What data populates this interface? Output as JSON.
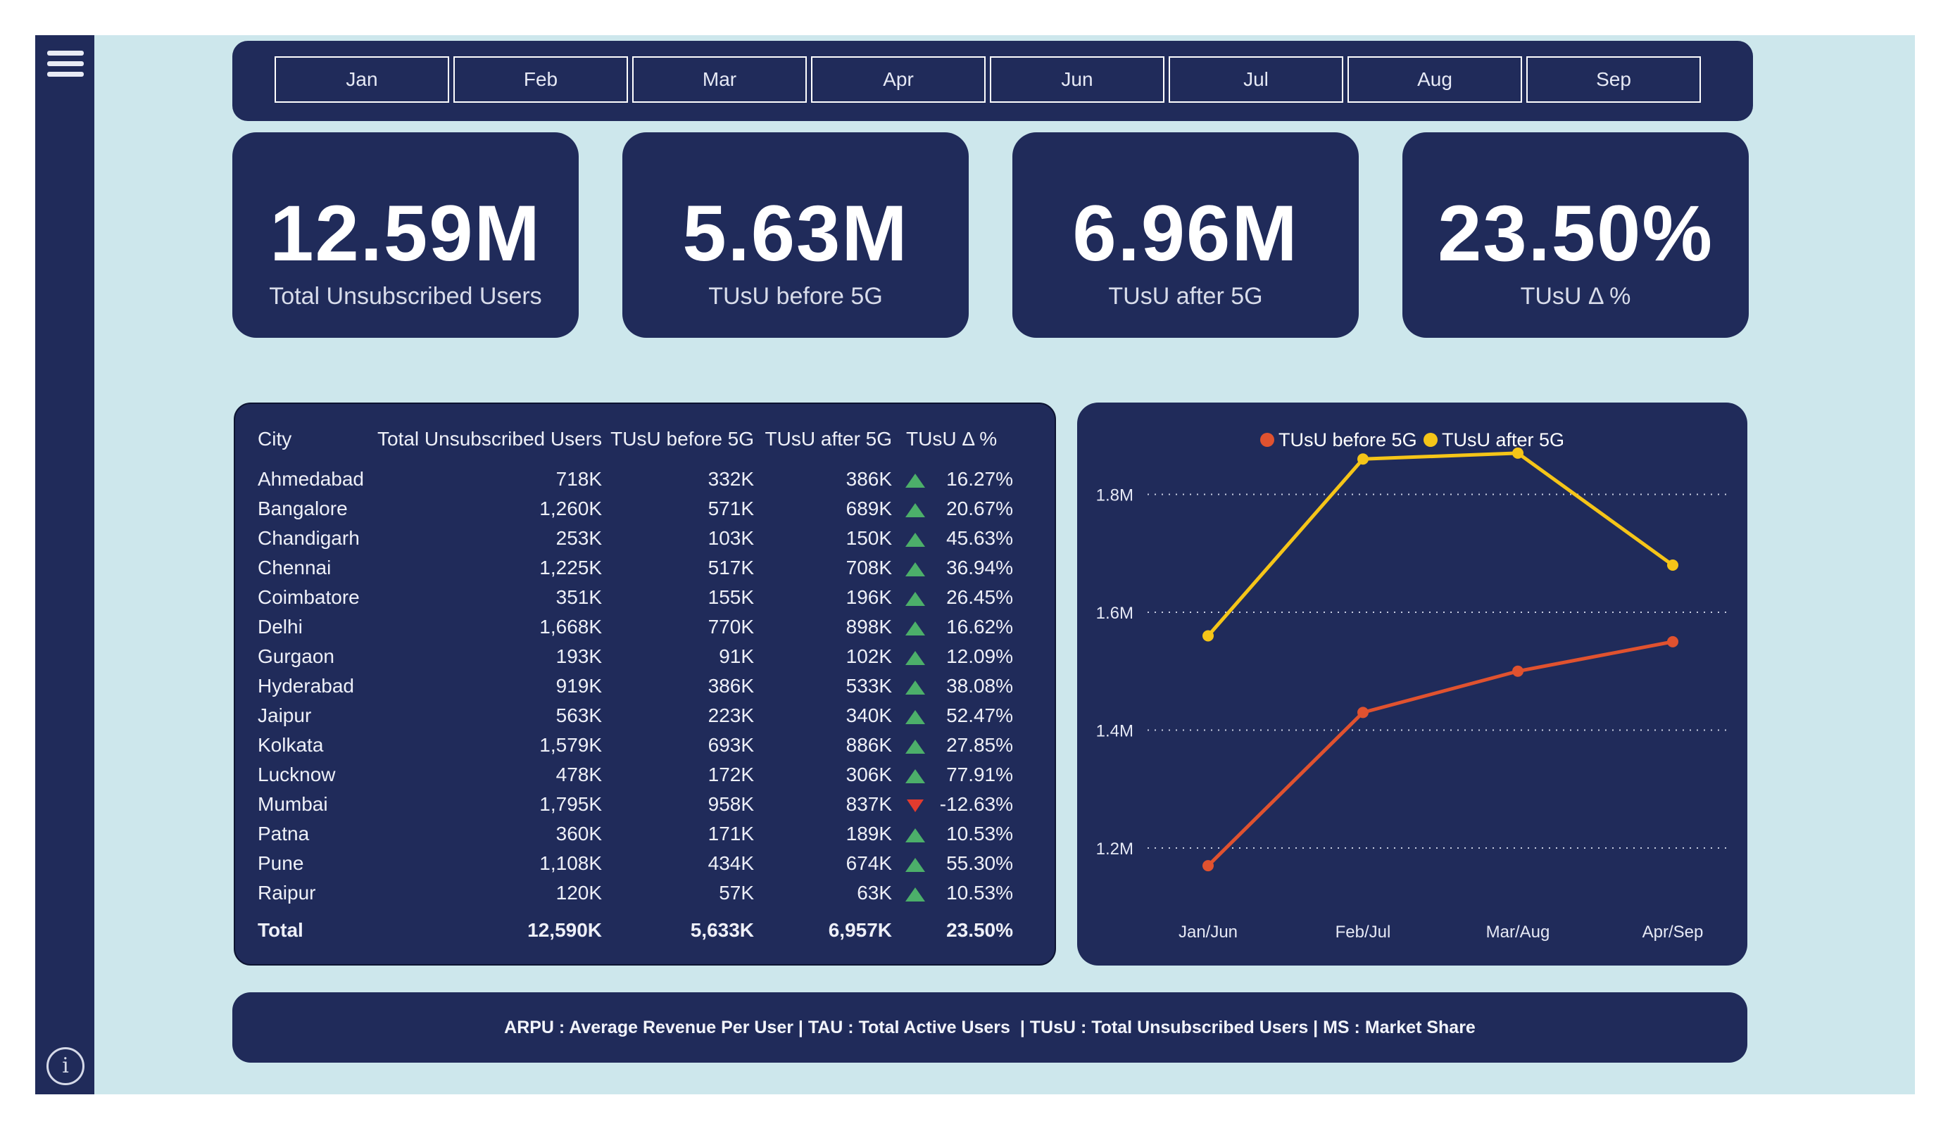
{
  "nav": {
    "months": [
      "Jan",
      "Feb",
      "Mar",
      "Apr",
      "Jun",
      "Jul",
      "Aug",
      "Sep"
    ],
    "info_label": "i"
  },
  "kpis": [
    {
      "value": "12.59M",
      "label": "Total Unsubscribed Users"
    },
    {
      "value": "5.63M",
      "label": "TUsU before 5G"
    },
    {
      "value": "6.96M",
      "label": "TUsU after 5G"
    },
    {
      "value": "23.50%",
      "label": "TUsU Δ %"
    }
  ],
  "table": {
    "headers": [
      "City",
      "Total Unsubscribed Users",
      "TUsU before 5G",
      "TUsU after 5G",
      "TUsU Δ %"
    ],
    "rows": [
      {
        "city": "Ahmedabad",
        "total": "718K",
        "before": "332K",
        "after": "386K",
        "trend": "up",
        "pct": "16.27%"
      },
      {
        "city": "Bangalore",
        "total": "1,260K",
        "before": "571K",
        "after": "689K",
        "trend": "up",
        "pct": "20.67%"
      },
      {
        "city": "Chandigarh",
        "total": "253K",
        "before": "103K",
        "after": "150K",
        "trend": "up",
        "pct": "45.63%"
      },
      {
        "city": "Chennai",
        "total": "1,225K",
        "before": "517K",
        "after": "708K",
        "trend": "up",
        "pct": "36.94%"
      },
      {
        "city": "Coimbatore",
        "total": "351K",
        "before": "155K",
        "after": "196K",
        "trend": "up",
        "pct": "26.45%"
      },
      {
        "city": "Delhi",
        "total": "1,668K",
        "before": "770K",
        "after": "898K",
        "trend": "up",
        "pct": "16.62%"
      },
      {
        "city": "Gurgaon",
        "total": "193K",
        "before": "91K",
        "after": "102K",
        "trend": "up",
        "pct": "12.09%"
      },
      {
        "city": "Hyderabad",
        "total": "919K",
        "before": "386K",
        "after": "533K",
        "trend": "up",
        "pct": "38.08%"
      },
      {
        "city": "Jaipur",
        "total": "563K",
        "before": "223K",
        "after": "340K",
        "trend": "up",
        "pct": "52.47%"
      },
      {
        "city": "Kolkata",
        "total": "1,579K",
        "before": "693K",
        "after": "886K",
        "trend": "up",
        "pct": "27.85%"
      },
      {
        "city": "Lucknow",
        "total": "478K",
        "before": "172K",
        "after": "306K",
        "trend": "up",
        "pct": "77.91%"
      },
      {
        "city": "Mumbai",
        "total": "1,795K",
        "before": "958K",
        "after": "837K",
        "trend": "down",
        "pct": "-12.63%"
      },
      {
        "city": "Patna",
        "total": "360K",
        "before": "171K",
        "after": "189K",
        "trend": "up",
        "pct": "10.53%"
      },
      {
        "city": "Pune",
        "total": "1,108K",
        "before": "434K",
        "after": "674K",
        "trend": "up",
        "pct": "55.30%"
      },
      {
        "city": "Raipur",
        "total": "120K",
        "before": "57K",
        "after": "63K",
        "trend": "up",
        "pct": "10.53%"
      }
    ],
    "total": {
      "city": "Total",
      "total": "12,590K",
      "before": "5,633K",
      "after": "6,957K",
      "pct": "23.50%"
    }
  },
  "chart_data": {
    "type": "line",
    "categories": [
      "Jan/Jun",
      "Feb/Jul",
      "Mar/Aug",
      "Apr/Sep"
    ],
    "series": [
      {
        "name": "TUsU before 5G",
        "color": "#e0522f",
        "values": [
          1.17,
          1.43,
          1.5,
          1.55
        ]
      },
      {
        "name": "TUsU after 5G",
        "color": "#f5c518",
        "values": [
          1.56,
          1.86,
          1.87,
          1.68
        ]
      }
    ],
    "yticks": [
      "1.2M",
      "1.4M",
      "1.6M",
      "1.8M"
    ],
    "ytick_values": [
      1.2,
      1.4,
      1.6,
      1.8
    ],
    "ylim": [
      1.12,
      1.92
    ],
    "legend_position": "top-center",
    "grid": true
  },
  "footer": {
    "text": "ARPU : Average Revenue Per User | TAU : Total Active Users  | TUsU : Total Unsubscribed Users | MS : Market Share"
  }
}
